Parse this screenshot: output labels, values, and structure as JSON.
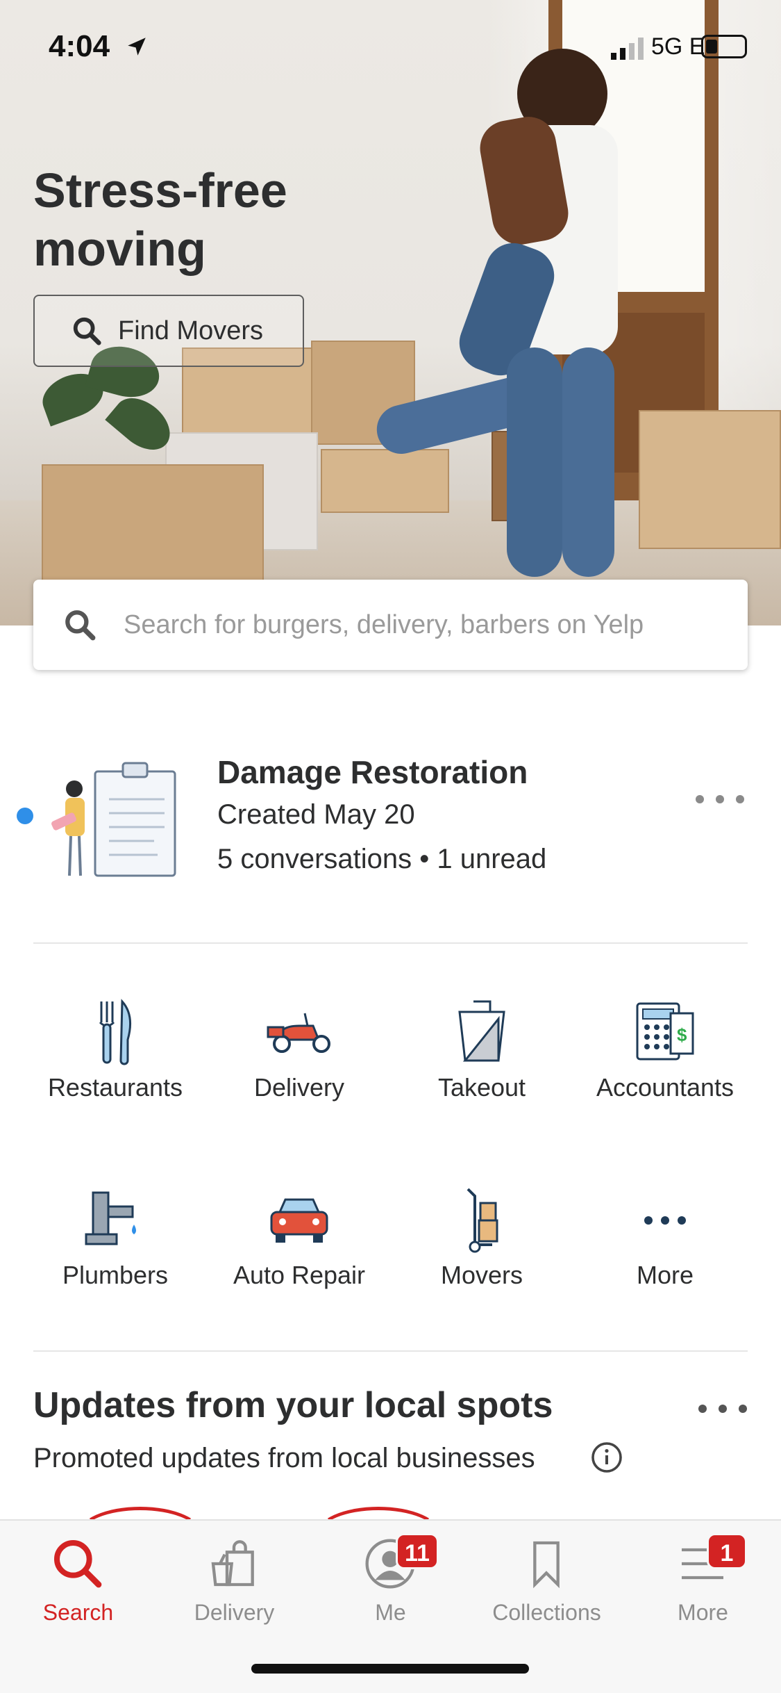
{
  "status_bar": {
    "time": "4:04",
    "network": "5G E"
  },
  "hero": {
    "title": "Stress-free moving",
    "button_label": "Find Movers"
  },
  "search": {
    "placeholder": "Search for burgers, delivery, barbers on Yelp"
  },
  "project": {
    "title": "Damage Restoration",
    "created": "Created May 20",
    "conversations": "5 conversations • 1 unread"
  },
  "categories": [
    {
      "label": "Restaurants",
      "icon": "fork-knife-icon"
    },
    {
      "label": "Delivery",
      "icon": "scooter-icon"
    },
    {
      "label": "Takeout",
      "icon": "takeout-box-icon"
    },
    {
      "label": "Accountants",
      "icon": "calculator-icon"
    },
    {
      "label": "Plumbers",
      "icon": "faucet-icon"
    },
    {
      "label": "Auto Repair",
      "icon": "car-icon"
    },
    {
      "label": "Movers",
      "icon": "hand-truck-icon"
    },
    {
      "label": "More",
      "icon": "more-dots-icon"
    }
  ],
  "updates": {
    "title": "Updates from your local spots",
    "subtitle": "Promoted updates from local businesses"
  },
  "tabs": [
    {
      "label": "Search",
      "icon": "search-icon",
      "active": true
    },
    {
      "label": "Delivery",
      "icon": "delivery-bag-icon"
    },
    {
      "label": "Me",
      "icon": "profile-icon",
      "badge": "11"
    },
    {
      "label": "Collections",
      "icon": "bookmark-icon"
    },
    {
      "label": "More",
      "icon": "menu-icon",
      "badge": "1"
    }
  ],
  "colors": {
    "brand_red": "#d32323",
    "unread_blue": "#2f8fe8",
    "text": "#2d2e2f"
  }
}
